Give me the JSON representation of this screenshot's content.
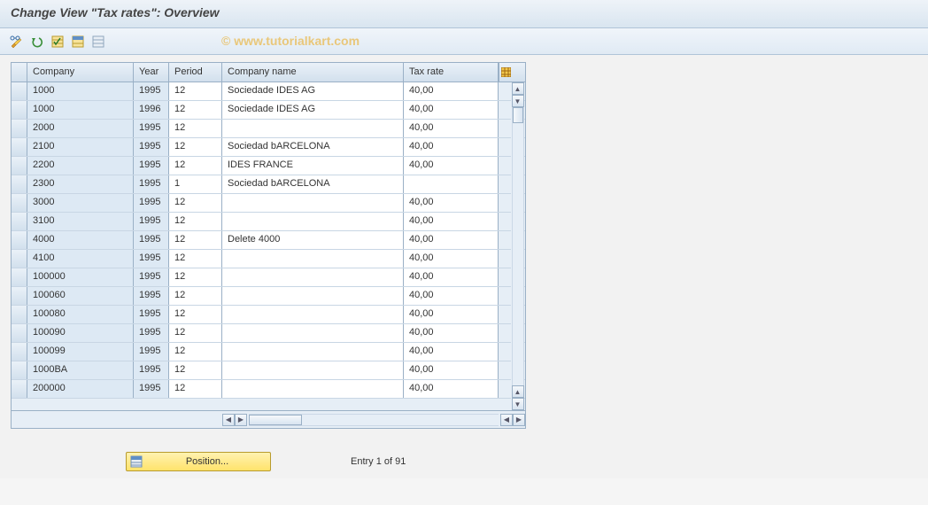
{
  "title": "Change View \"Tax rates\": Overview",
  "watermark": "© www.tutorialkart.com",
  "toolbar": {
    "buttons": [
      "edit-icon",
      "undo-icon",
      "new-entries-icon",
      "copy-as-icon",
      "delete-icon"
    ]
  },
  "table": {
    "headers": {
      "company": "Company",
      "year": "Year",
      "period": "Period",
      "name": "Company name",
      "taxrate": "Tax rate"
    },
    "rows": [
      {
        "company": "1000",
        "year": "1995",
        "period": "12",
        "name": "Sociedade IDES AG",
        "taxrate": "40,00"
      },
      {
        "company": "1000",
        "year": "1996",
        "period": "12",
        "name": "Sociedade IDES AG",
        "taxrate": "40,00"
      },
      {
        "company": "2000",
        "year": "1995",
        "period": "12",
        "name": "",
        "taxrate": "40,00"
      },
      {
        "company": "2100",
        "year": "1995",
        "period": "12",
        "name": "Sociedad bARCELONA",
        "taxrate": "40,00"
      },
      {
        "company": "2200",
        "year": "1995",
        "period": "12",
        "name": "IDES FRANCE",
        "taxrate": "40,00"
      },
      {
        "company": "2300",
        "year": "1995",
        "period": "1",
        "name": "Sociedad bARCELONA",
        "taxrate": ""
      },
      {
        "company": "3000",
        "year": "1995",
        "period": "12",
        "name": "",
        "taxrate": "40,00"
      },
      {
        "company": "3100",
        "year": "1995",
        "period": "12",
        "name": "",
        "taxrate": "40,00"
      },
      {
        "company": "4000",
        "year": "1995",
        "period": "12",
        "name": "Delete 4000",
        "taxrate": "40,00"
      },
      {
        "company": "4100",
        "year": "1995",
        "period": "12",
        "name": "",
        "taxrate": "40,00"
      },
      {
        "company": "100000",
        "year": "1995",
        "period": "12",
        "name": "",
        "taxrate": "40,00"
      },
      {
        "company": "100060",
        "year": "1995",
        "period": "12",
        "name": "",
        "taxrate": "40,00"
      },
      {
        "company": "100080",
        "year": "1995",
        "period": "12",
        "name": "",
        "taxrate": "40,00"
      },
      {
        "company": "100090",
        "year": "1995",
        "period": "12",
        "name": "",
        "taxrate": "40,00"
      },
      {
        "company": "100099",
        "year": "1995",
        "period": "12",
        "name": "",
        "taxrate": "40,00"
      },
      {
        "company": "1000BA",
        "year": "1995",
        "period": "12",
        "name": "",
        "taxrate": "40,00"
      },
      {
        "company": "200000",
        "year": "1995",
        "period": "12",
        "name": "",
        "taxrate": "40,00"
      }
    ]
  },
  "footer": {
    "position_label": "Position...",
    "entry_status": "Entry 1 of 91"
  }
}
